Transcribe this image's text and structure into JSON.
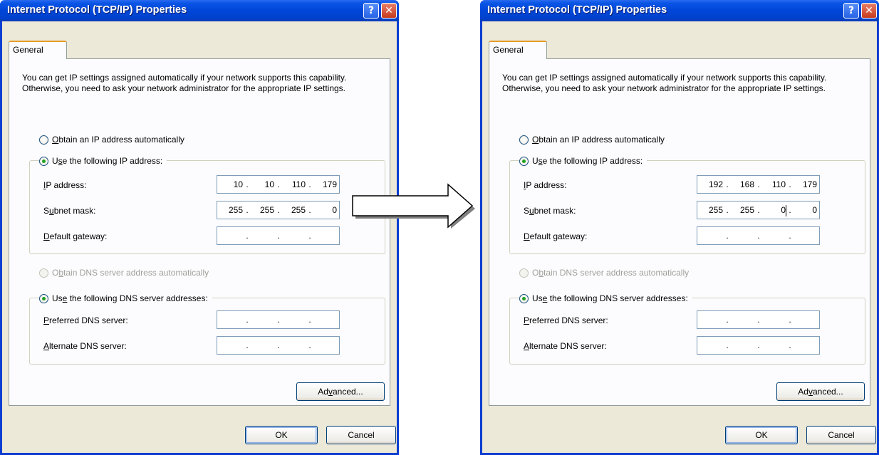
{
  "left_window": {
    "title": "Internet Protocol (TCP/IP) Properties",
    "help_glyph": "?",
    "close_glyph": "✕",
    "tab": "General",
    "description": "You can get IP settings assigned automatically if your network supports this capability. Otherwise, you need to ask your network administrator for the appropriate IP settings.",
    "obtain_ip": {
      "pre": "",
      "mn": "O",
      "post": "btain an IP address automatically"
    },
    "use_ip": {
      "pre": "U",
      "mn": "s",
      "post": "e the following IP address:"
    },
    "ip_label": {
      "pre": "",
      "mn": "I",
      "post": "P address:"
    },
    "ip": [
      "10",
      "10",
      "110",
      "179"
    ],
    "subnet_label": {
      "pre": "S",
      "mn": "u",
      "post": "bnet mask:"
    },
    "subnet": [
      "255",
      "255",
      "255",
      "0"
    ],
    "gateway_label": {
      "pre": "",
      "mn": "D",
      "post": "efault gateway:"
    },
    "gateway": [
      "",
      "",
      "",
      ""
    ],
    "obtain_dns": {
      "pre": "O",
      "mn": "b",
      "post": "tain DNS server address automatically"
    },
    "use_dns": {
      "pre": "Us",
      "mn": "e",
      "post": " the following DNS server addresses:"
    },
    "pref_dns_label": {
      "pre": "",
      "mn": "P",
      "post": "referred DNS server:"
    },
    "pref_dns": [
      "",
      "",
      "",
      ""
    ],
    "alt_dns_label": {
      "pre": "",
      "mn": "A",
      "post": "lternate DNS server:"
    },
    "alt_dns": [
      "",
      "",
      "",
      ""
    ],
    "advanced": {
      "pre": "Ad",
      "mn": "v",
      "post": "anced..."
    },
    "ok": "OK",
    "cancel": "Cancel"
  },
  "right_window": {
    "title": "Internet Protocol (TCP/IP) Properties",
    "help_glyph": "?",
    "close_glyph": "✕",
    "tab": "General",
    "description": "You can get IP settings assigned automatically if your network supports this capability. Otherwise, you need to ask your network administrator for the appropriate IP settings.",
    "obtain_ip": {
      "pre": "",
      "mn": "O",
      "post": "btain an IP address automatically"
    },
    "use_ip": {
      "pre": "U",
      "mn": "s",
      "post": "e the following IP address:"
    },
    "ip_label": {
      "pre": "",
      "mn": "I",
      "post": "P address:"
    },
    "ip": [
      "192",
      "168",
      "110",
      "179"
    ],
    "subnet_label": {
      "pre": "S",
      "mn": "u",
      "post": "bnet mask:"
    },
    "subnet": [
      "255",
      "255",
      "0",
      "0"
    ],
    "gateway_label": {
      "pre": "",
      "mn": "D",
      "post": "efault gateway:"
    },
    "gateway": [
      "",
      "",
      "",
      ""
    ],
    "obtain_dns": {
      "pre": "O",
      "mn": "b",
      "post": "tain DNS server address automatically"
    },
    "use_dns": {
      "pre": "Us",
      "mn": "e",
      "post": " the following DNS server addresses:"
    },
    "pref_dns_label": {
      "pre": "",
      "mn": "P",
      "post": "referred DNS server:"
    },
    "pref_dns": [
      "",
      "",
      "",
      ""
    ],
    "alt_dns_label": {
      "pre": "",
      "mn": "A",
      "post": "lternate DNS server:"
    },
    "alt_dns": [
      "",
      "",
      "",
      ""
    ],
    "advanced": {
      "pre": "Ad",
      "mn": "v",
      "post": "anced..."
    },
    "ok": "OK",
    "cancel": "Cancel"
  },
  "ip_dot": ".",
  "arrow_icon": "right-arrow-icon",
  "colors": {
    "titlebar": "#0046d8",
    "dialog_bg": "#ece9d8",
    "radio_checked": "#21a121",
    "tab_highlight": "#e69c2a"
  }
}
